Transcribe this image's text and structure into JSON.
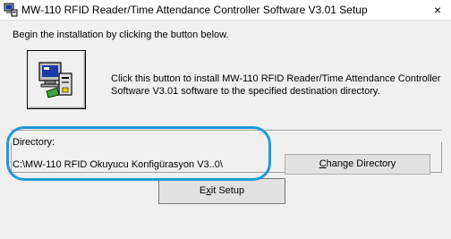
{
  "window": {
    "title": "MW-110 RFID Reader/Time Attendance Controller Software V3.01 Setup",
    "close_glyph": "×",
    "app_icon": "setup-computer-icon"
  },
  "intro_text": "Begin the installation by clicking the button below.",
  "install": {
    "icon": "setup-computer-icon",
    "description": "Click this button to install MW-110 RFID Reader/Time Attendance Controller Software V3.01 software to the specified destination directory."
  },
  "directory": {
    "label": "Directory:",
    "path": "C:\\MW-110 RFID Okuyucu Konfigürasyon V3..0\\",
    "change_button_label": "Change Directory"
  },
  "exit_button_label": "Exit Setup",
  "colors": {
    "highlight_ellipse": "#1f9ad6",
    "desktop_background": "#1a2a8c"
  }
}
